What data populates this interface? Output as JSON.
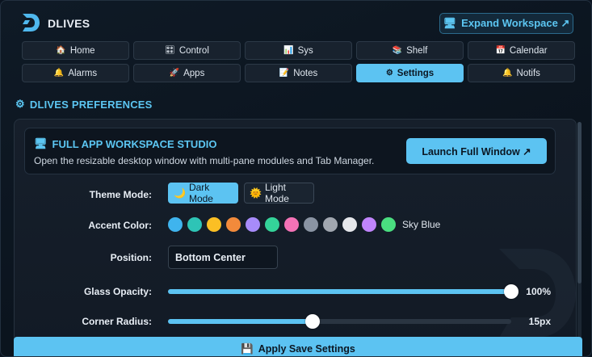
{
  "app": {
    "title": "DLIVES"
  },
  "header": {
    "expand_label": "Expand Workspace ↗"
  },
  "nav": [
    {
      "icon": "🏠",
      "label": "Home"
    },
    {
      "icon": "🎛",
      "label": "Control"
    },
    {
      "icon": "📊",
      "label": "Sys"
    },
    {
      "icon": "📚",
      "label": "Shelf"
    },
    {
      "icon": "📅",
      "label": "Calendar"
    },
    {
      "icon": "🔔",
      "label": "Alarms"
    },
    {
      "icon": "🚀",
      "label": "Apps"
    },
    {
      "icon": "📝",
      "label": "Notes"
    },
    {
      "icon": "⚙",
      "label": "Settings",
      "active": true
    },
    {
      "icon": "🔔",
      "label": "Notifs"
    }
  ],
  "section": {
    "icon": "⚙",
    "title": "DLIVES PREFERENCES"
  },
  "studio": {
    "icon": "🖥",
    "title": "FULL APP WORKSPACE STUDIO",
    "description": "Open the resizable desktop window with multi-pane modules and Tab Manager.",
    "launch_label": "Launch Full Window ↗"
  },
  "theme": {
    "label": "Theme Mode:",
    "dark_icon": "🌙",
    "dark_label": "Dark Mode",
    "light_icon": "🌞",
    "light_label": "Light Mode",
    "selected": "dark"
  },
  "accent": {
    "label": "Accent Color:",
    "colors": [
      "#3fb4ee",
      "#2ec4b6",
      "#fbbf24",
      "#f28a3b",
      "#a78bfa",
      "#34d399",
      "#f472b6",
      "#8a94a3",
      "#a1a7b0",
      "#e5e7eb",
      "#c084fc",
      "#4ade80"
    ],
    "selected_name": "Sky Blue"
  },
  "position": {
    "label": "Position:",
    "value": "Bottom Center"
  },
  "opacity": {
    "label": "Glass Opacity:",
    "value_text": "100%",
    "fraction": 1.0
  },
  "radius": {
    "label": "Corner Radius:",
    "value_text": "15px",
    "fraction": 0.42
  },
  "apply": {
    "icon": "💾",
    "label": "Apply  Save Settings"
  },
  "colors": {
    "accent": "#5cc3f2",
    "background": "#0b1420"
  }
}
